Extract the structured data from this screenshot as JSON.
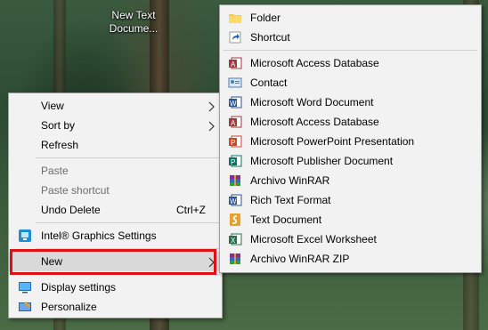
{
  "desktop": {
    "icon_label_line1": "New Text",
    "icon_label_line2": "Docume..."
  },
  "context_menu": {
    "items": [
      {
        "label": "View",
        "has_submenu": true
      },
      {
        "label": "Sort by",
        "has_submenu": true
      },
      {
        "label": "Refresh"
      },
      {
        "label": "Paste",
        "disabled": true
      },
      {
        "label": "Paste shortcut",
        "disabled": true
      },
      {
        "label": "Undo Delete",
        "shortcut": "Ctrl+Z"
      },
      {
        "label": "Intel® Graphics Settings",
        "icon": "intel-graphics-icon"
      },
      {
        "label": "New",
        "has_submenu": true,
        "highlighted": true
      },
      {
        "label": "Display settings",
        "icon": "display-settings-icon"
      },
      {
        "label": "Personalize",
        "icon": "personalize-icon"
      }
    ]
  },
  "new_submenu": {
    "items": [
      {
        "label": "Folder",
        "icon": "folder-icon"
      },
      {
        "label": "Shortcut",
        "icon": "shortcut-icon"
      },
      {
        "label": "Microsoft Access Database",
        "icon": "access-icon"
      },
      {
        "label": "Contact",
        "icon": "contact-icon"
      },
      {
        "label": "Microsoft Word Document",
        "icon": "word-icon"
      },
      {
        "label": "Microsoft Access Database",
        "icon": "access-icon"
      },
      {
        "label": "Microsoft PowerPoint Presentation",
        "icon": "powerpoint-icon"
      },
      {
        "label": "Microsoft Publisher Document",
        "icon": "publisher-icon"
      },
      {
        "label": "Archivo WinRAR",
        "icon": "winrar-icon"
      },
      {
        "label": "Rich Text Format",
        "icon": "rtf-icon"
      },
      {
        "label": "Text Document",
        "icon": "text-document-icon"
      },
      {
        "label": "Microsoft Excel Worksheet",
        "icon": "excel-icon"
      },
      {
        "label": "Archivo WinRAR ZIP",
        "icon": "winrar-zip-icon"
      }
    ]
  },
  "colors": {
    "highlight_border": "#e00f14",
    "menu_background": "#f2f2f2",
    "disabled_text": "#6d6d6d"
  }
}
